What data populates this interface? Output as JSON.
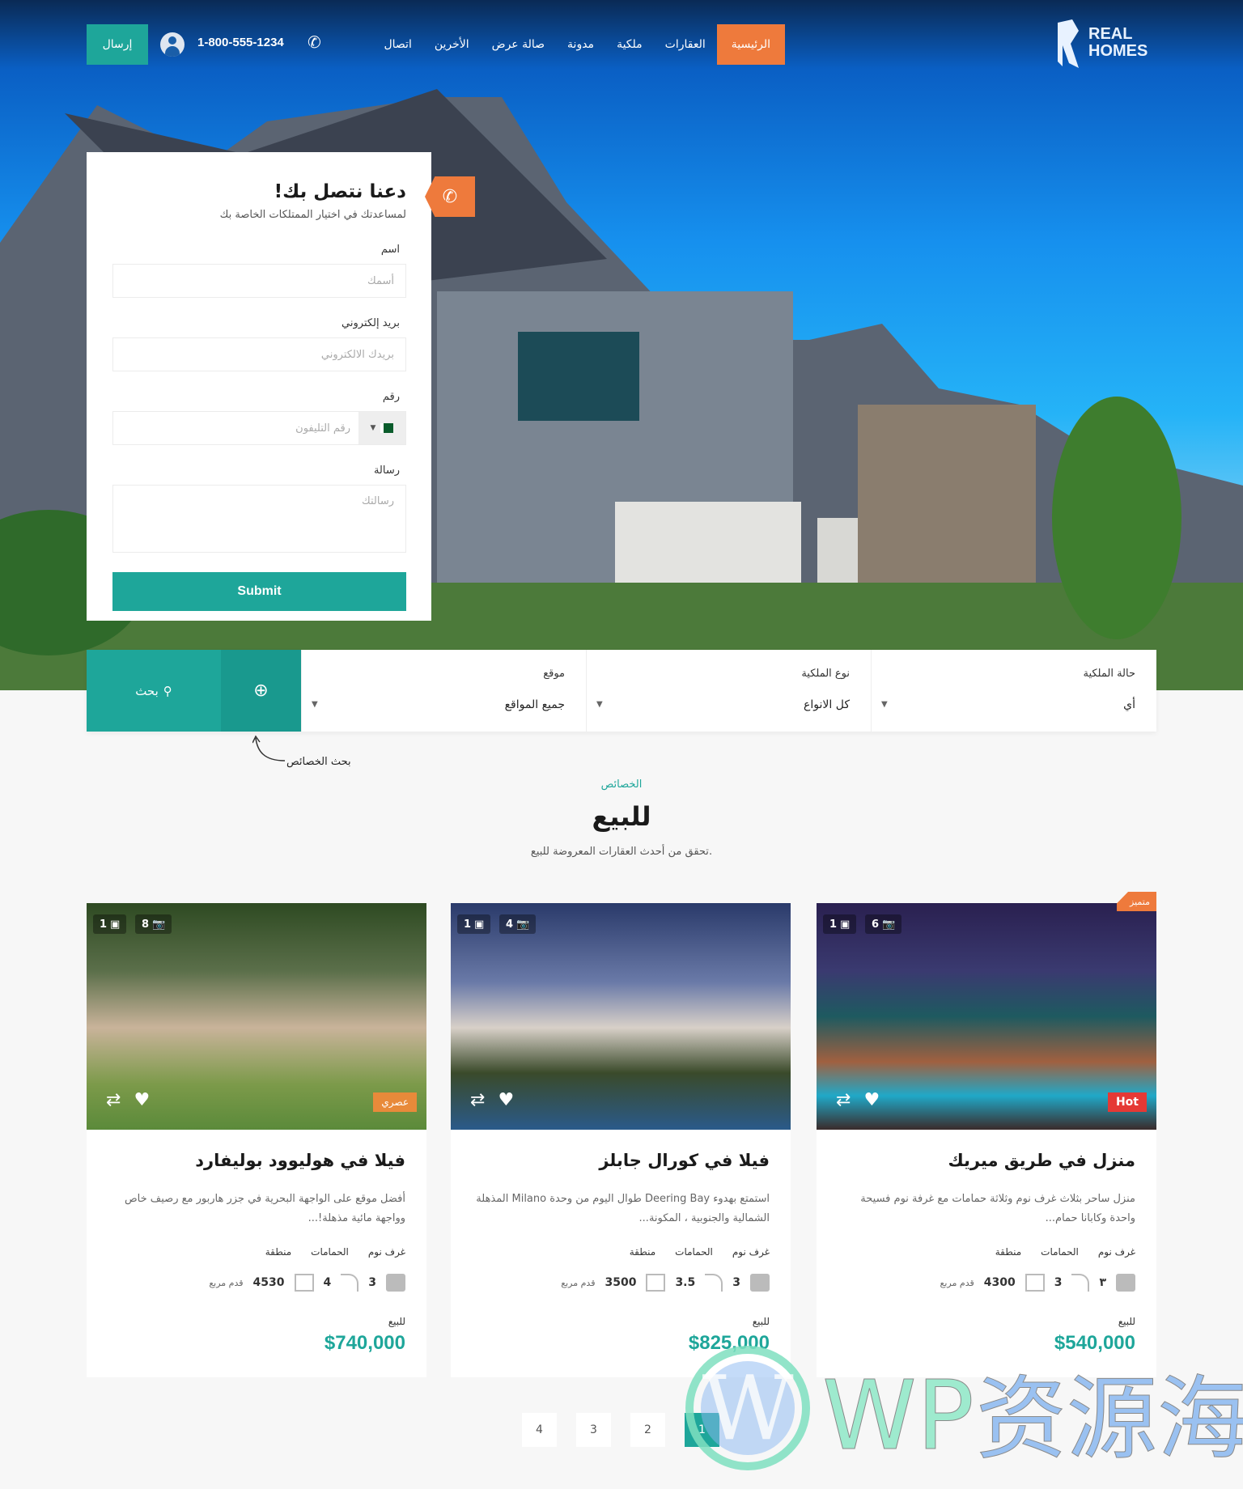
{
  "colors": {
    "accent": "#1ea69a",
    "orange": "#ee7a3c",
    "hot": "#e53935"
  },
  "nav": {
    "send_label": "إرسال",
    "phone": "1-800-555-1234",
    "phone_icon": "phone-icon",
    "user_icon": "user-icon",
    "items": [
      {
        "label": "الرئيسية",
        "active": true
      },
      {
        "label": "العقارات"
      },
      {
        "label": "ملكية"
      },
      {
        "label": "مدونة"
      },
      {
        "label": "صالة عرض"
      },
      {
        "label": "الأخرين"
      },
      {
        "label": "اتصال"
      }
    ],
    "logo": "REAL HOMES"
  },
  "form": {
    "title": "دعنا نتصل بك!",
    "subtitle": "لمساعدتك في اختيار الممتلكات الخاصة بك",
    "name_label": "اسم",
    "name_placeholder": "أسمك",
    "email_label": "بريد إلكتروني",
    "email_placeholder": "بريدك الالكتروني",
    "phone_label": "رقم",
    "phone_placeholder": "رقم التليفون",
    "message_label": "رسالة",
    "message_placeholder": "رسالتك",
    "submit": "Submit"
  },
  "search": {
    "button": "بحث",
    "fields": [
      {
        "label": "حالة الملكية",
        "value": "أي"
      },
      {
        "label": "نوع الملكية",
        "value": "كل الانواع"
      },
      {
        "label": "موقع",
        "value": "جميع المواقع"
      }
    ],
    "annotation": "بحث الخصائص"
  },
  "section": {
    "label": "الخصائص",
    "title": "للبيع",
    "subtitle": "تحقق من أحدث العقارات المعروضة للبيع."
  },
  "cards": [
    {
      "title": "فيلا في هوليوود بوليفارد",
      "desc": "أفضل موقع على الواجهة البحرية في جزر هاربور مع رصيف خاص وواجهة مائية مذهلة!...",
      "videos": "1",
      "photos": "8",
      "tag": "عصري",
      "featured": "",
      "beds": "3",
      "baths": "4",
      "area": "4530",
      "unit": "قدم مربع",
      "status": "للبيع",
      "price": "$740,000"
    },
    {
      "title": "فيلا في كورال جابلز",
      "desc": "استمتع بهدوء Deering Bay طوال اليوم من وحدة Milano المذهلة الشمالية والجنوبية ، المكونة...",
      "videos": "1",
      "photos": "4",
      "tag": "",
      "featured": "",
      "beds": "3",
      "baths": "3.5",
      "area": "3500",
      "unit": "قدم مربع",
      "status": "للبيع",
      "price": "$825,000"
    },
    {
      "title": "منزل في طريق ميريك",
      "desc": "منزل ساحر بثلاث غرف نوم وثلاثة حمامات مع غرفة نوم فسيحة واحدة وكابانا حمام...",
      "videos": "1",
      "photos": "6",
      "tag": "Hot",
      "featured": "متميز",
      "beds": "٣",
      "baths": "3",
      "area": "4300",
      "unit": "قدم مربع",
      "status": "للبيع",
      "price": "$540,000"
    }
  ],
  "meta_labels": {
    "beds": "غرف نوم",
    "baths": "الحمامات",
    "area": "منطقة"
  },
  "pagination": {
    "pages": [
      "4",
      "3",
      "2",
      "1"
    ],
    "current": "1"
  },
  "watermark": "WP资源海"
}
